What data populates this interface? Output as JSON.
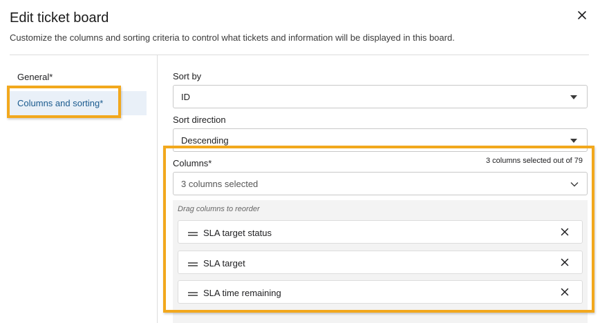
{
  "dialog": {
    "title": "Edit ticket board",
    "subtitle": "Customize the columns and sorting criteria to control what tickets and information will be displayed in this board.",
    "close_icon": "close-icon"
  },
  "sidebar": {
    "items": [
      {
        "label": "General*",
        "active": false
      },
      {
        "label": "Columns and sorting*",
        "active": true
      }
    ]
  },
  "form": {
    "sort_by_label": "Sort by",
    "sort_by_value": "ID",
    "sort_direction_label": "Sort direction",
    "sort_direction_value": "Descending",
    "columns_label": "Columns*",
    "columns_count_text": "3 columns selected out of 79",
    "columns_select_value": "3 columns selected",
    "reorder_hint": "Drag columns to reorder",
    "columns": [
      {
        "name": "SLA target status"
      },
      {
        "name": "SLA target"
      },
      {
        "name": "SLA time remaining"
      }
    ]
  },
  "colors": {
    "highlight": "#f2a81d",
    "active_nav_bg": "#e9f0f8",
    "active_nav_text": "#1a5a8e"
  }
}
